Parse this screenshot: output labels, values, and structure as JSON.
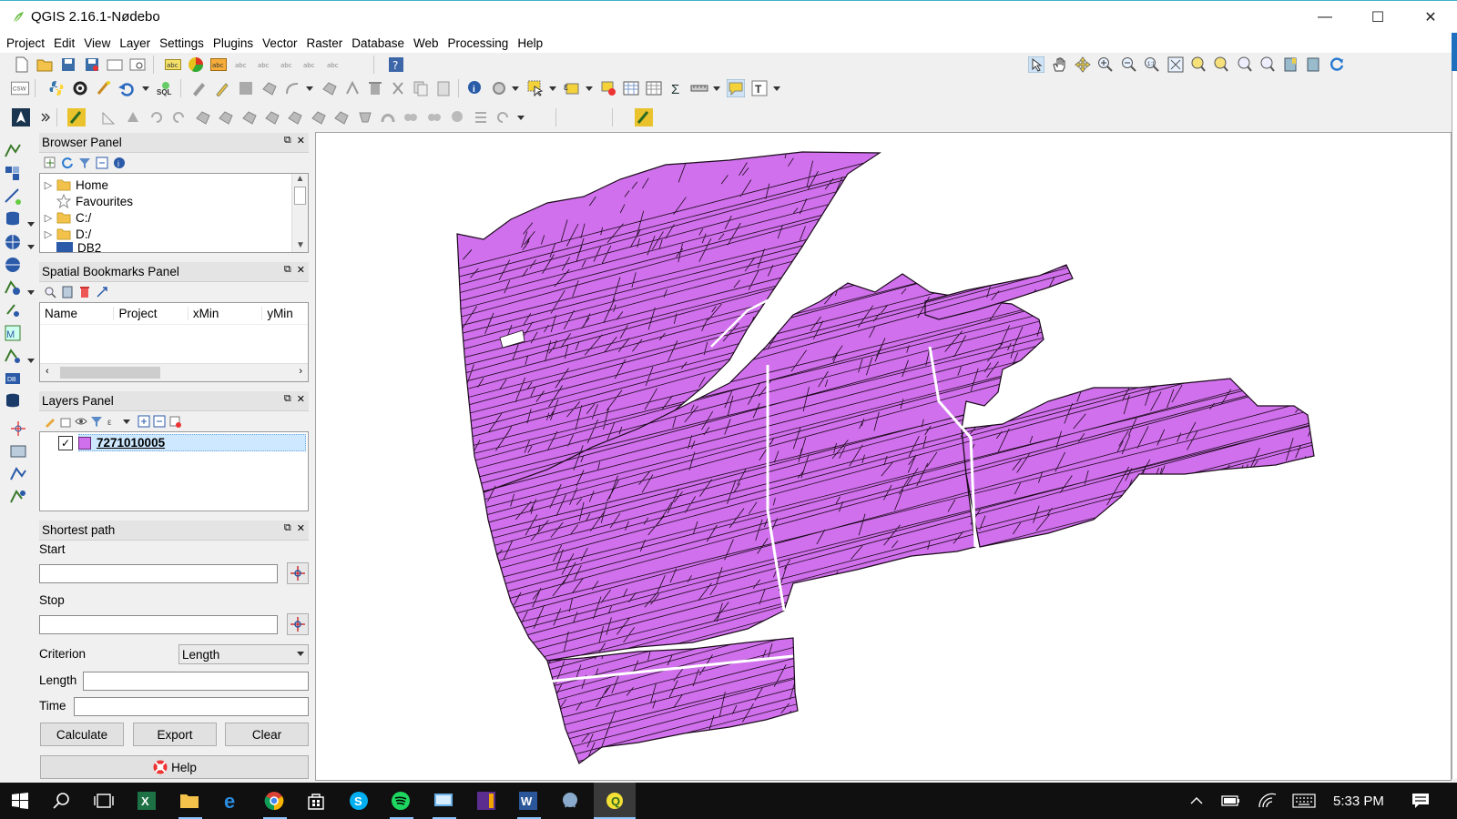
{
  "window": {
    "title": "QGIS 2.16.1-Nødebo",
    "minimize": "—",
    "maximize": "☐",
    "close": "✕"
  },
  "menu": [
    "Project",
    "Edit",
    "View",
    "Layer",
    "Settings",
    "Plugins",
    "Vector",
    "Raster",
    "Database",
    "Web",
    "Processing",
    "Help"
  ],
  "browser_panel": {
    "title": "Browser Panel",
    "items": [
      {
        "label": "Home",
        "icon": "folder-icon"
      },
      {
        "label": "Favourites",
        "icon": "star-icon"
      },
      {
        "label": "C:/",
        "icon": "folder-icon"
      },
      {
        "label": "D:/",
        "icon": "folder-icon"
      },
      {
        "label": "DB2",
        "icon": "db2-icon"
      }
    ]
  },
  "bookmarks_panel": {
    "title": "Spatial Bookmarks Panel",
    "columns": [
      "Name",
      "Project",
      "xMin",
      "yMin"
    ]
  },
  "layers_panel": {
    "title": "Layers Panel",
    "layers": [
      {
        "name": "7271010005",
        "checked": true,
        "color": "#d070ec"
      }
    ]
  },
  "shortest_path": {
    "title": "Shortest path",
    "start_label": "Start",
    "stop_label": "Stop",
    "criterion_label": "Criterion",
    "criterion_value": "Length",
    "length_label": "Length",
    "time_label": "Time",
    "calculate": "Calculate",
    "export": "Export",
    "clear": "Clear",
    "help": "Help"
  },
  "map": {
    "fill": "#d070ec",
    "stroke": "#1a0a1a"
  },
  "taskbar": {
    "time": "5:33 PM"
  }
}
